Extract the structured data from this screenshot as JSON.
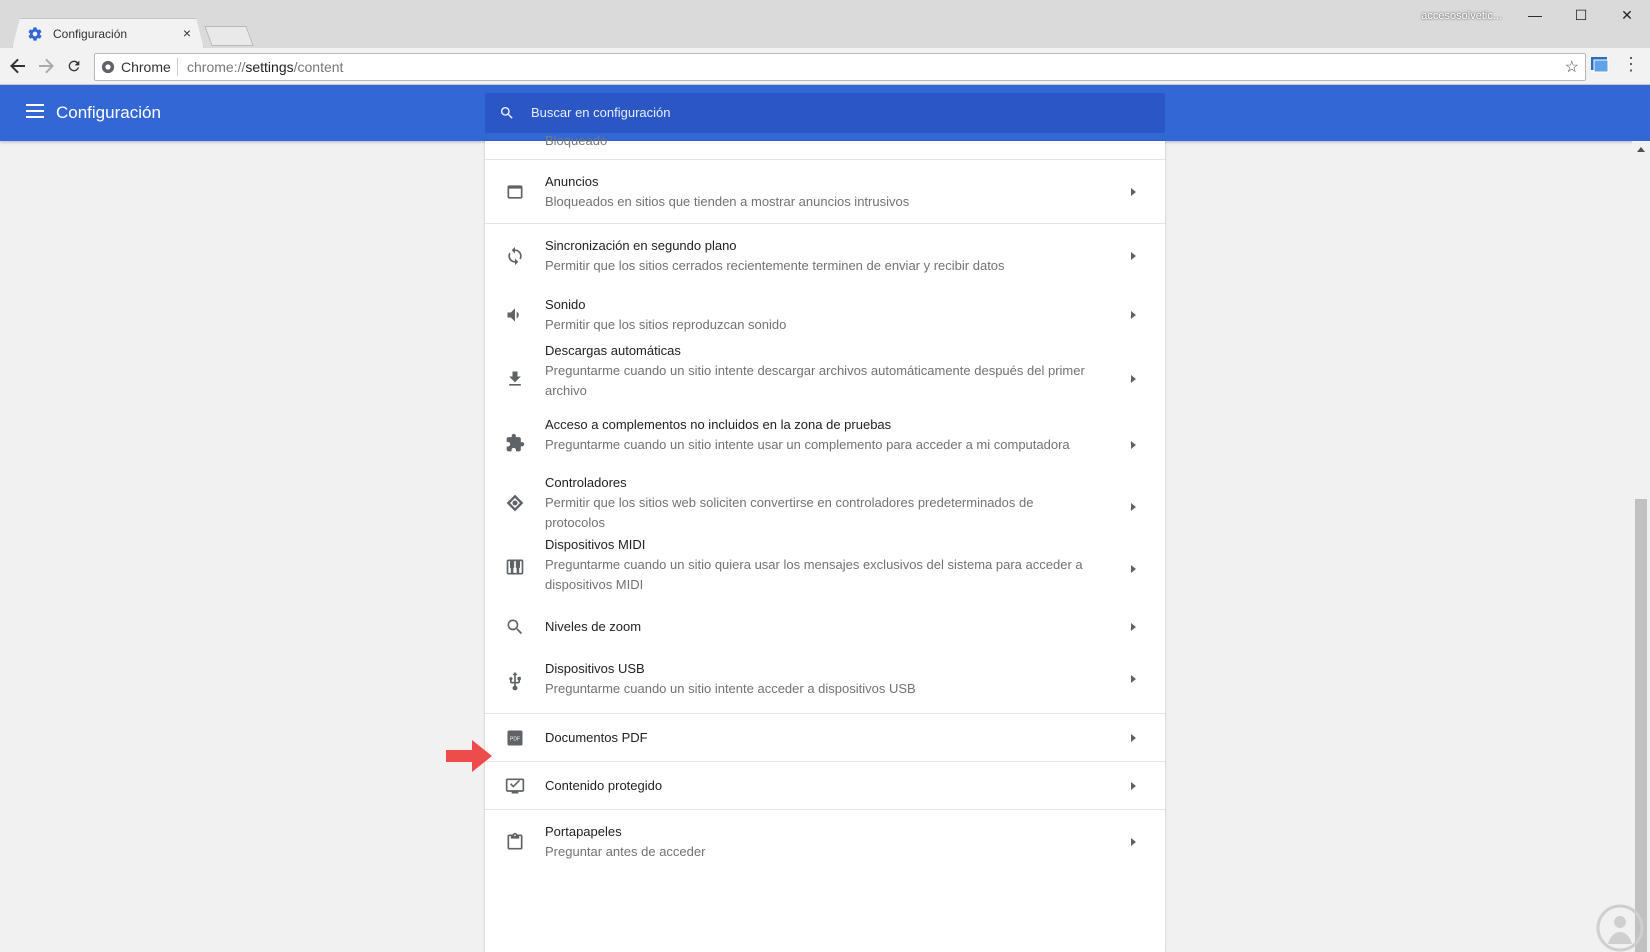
{
  "window": {
    "tab_title": "Configuración",
    "tab_close": "×",
    "profile_name": "accesosolvetic...",
    "minimize": "—",
    "maximize": "☐",
    "close": "✕"
  },
  "toolbar": {
    "chip_label": "Chrome",
    "url_prefix": "chrome://",
    "url_host": "settings",
    "url_path": "/content",
    "star": "☆",
    "menu": "⋮"
  },
  "header": {
    "title": "Configuración",
    "search_placeholder": "Buscar en configuración"
  },
  "content": {
    "cut_off_text": "Bloqueado",
    "items": [
      {
        "label": "Anuncios",
        "sub": "Bloqueados en sitios que tienden a mostrar anuncios intrusivos",
        "icon": "ads-icon"
      },
      {
        "label": "Sincronización en segundo plano",
        "sub": "Permitir que los sitios cerrados recientemente terminen de enviar y recibir datos",
        "icon": "sync-icon"
      },
      {
        "label": "Sonido",
        "sub": "Permitir que los sitios reproduzcan sonido",
        "icon": "volume-icon"
      },
      {
        "label": "Descargas automáticas",
        "sub": "Preguntarme cuando un sitio intente descargar archivos automáticamente después del primer archivo",
        "icon": "download-icon"
      },
      {
        "label": "Acceso a complementos no incluidos en la zona de pruebas",
        "sub": "Preguntarme cuando un sitio intente usar un complemento para acceder a mi computadora",
        "icon": "puzzle-icon"
      },
      {
        "label": "Controladores",
        "sub": "Permitir que los sitios web soliciten convertirse en controladores predeterminados de protocolos",
        "icon": "handler-icon"
      },
      {
        "label": "Dispositivos MIDI",
        "sub": "Preguntarme cuando un sitio quiera usar los mensajes exclusivos del sistema para acceder a dispositivos MIDI",
        "icon": "midi-icon"
      },
      {
        "label": "Niveles de zoom",
        "sub": "",
        "icon": "zoom-icon"
      },
      {
        "label": "Dispositivos USB",
        "sub": "Preguntarme cuando un sitio intente acceder a dispositivos USB",
        "icon": "usb-icon"
      },
      {
        "label": "Documentos PDF",
        "sub": "",
        "icon": "pdf-icon"
      },
      {
        "label": "Contenido protegido",
        "sub": "",
        "icon": "protected-content-icon"
      },
      {
        "label": "Portapapeles",
        "sub": "Preguntar antes de acceder",
        "icon": "clipboard-icon"
      }
    ]
  },
  "colors": {
    "header_blue": "#3367d6",
    "search_blue": "#2a56c6",
    "annotation_red": "#ee4b4b"
  }
}
